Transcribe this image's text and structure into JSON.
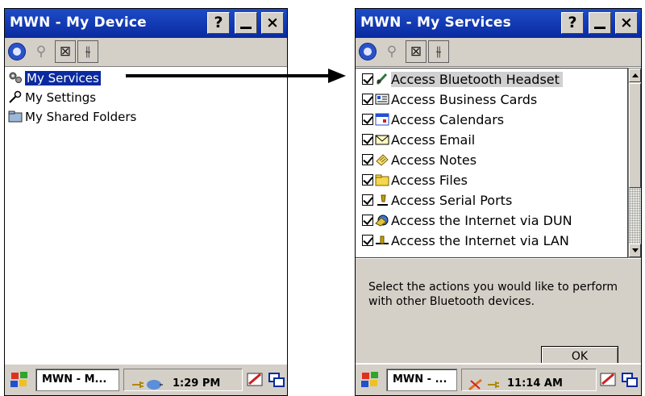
{
  "left_window": {
    "title": "MWN - My Device",
    "help_label": "?",
    "close_label": "×",
    "tree_items": [
      {
        "label": "My Services",
        "icon": "gears-icon",
        "selected": true
      },
      {
        "label": "My Settings",
        "icon": "wrench-icon"
      },
      {
        "label": "My Shared Folders",
        "icon": "folder-icon"
      }
    ],
    "taskbar": {
      "task_label": "MWN - M...",
      "clock": "1:29 PM"
    }
  },
  "right_window": {
    "title": "MWN - My Services",
    "help_label": "?",
    "close_label": "×",
    "services": [
      {
        "label": "Access Bluetooth Headset",
        "icon": "headset-icon",
        "checked": true
      },
      {
        "label": "Access Business Cards",
        "icon": "business-card-icon",
        "checked": true
      },
      {
        "label": "Access Calendars",
        "icon": "calendar-icon",
        "checked": true
      },
      {
        "label": "Access Email",
        "icon": "envelope-icon",
        "checked": true
      },
      {
        "label": "Access Notes",
        "icon": "notes-icon",
        "checked": true
      },
      {
        "label": "Access Files",
        "icon": "folder-icon",
        "checked": true
      },
      {
        "label": "Access Serial Ports",
        "icon": "serial-port-icon",
        "checked": true
      },
      {
        "label": "Access the Internet via DUN",
        "icon": "dialup-icon",
        "checked": true
      },
      {
        "label": "Access the Internet via LAN",
        "icon": "lan-icon",
        "checked": true
      }
    ],
    "description": "Select the actions you would like to perform with other Bluetooth devices.",
    "ok_label": "OK",
    "taskbar": {
      "task_label": "MWN - ...",
      "clock": "11:14 AM"
    }
  },
  "colors": {
    "titlebar": "#0a2aa0",
    "chrome": "#d4d0c8",
    "selection": "#0a2aa0"
  }
}
